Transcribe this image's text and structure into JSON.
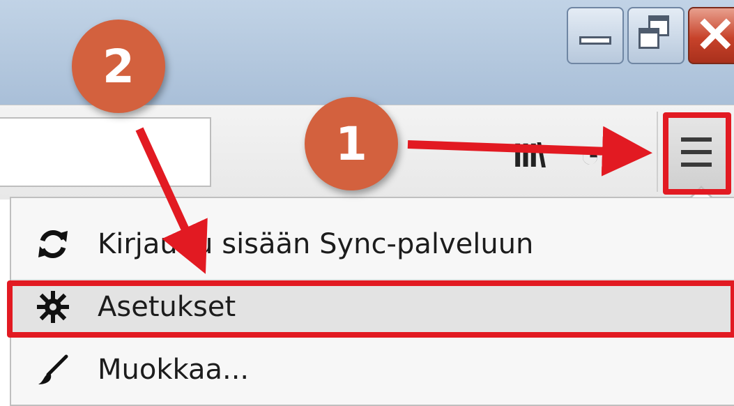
{
  "window": {
    "close_glyph": "✕"
  },
  "toolbar": {
    "bookmarks_icon": "bookmarks-icon",
    "history_icon": "history-icon",
    "menu_button_icon": "hamburger-menu-icon"
  },
  "menu": {
    "items": [
      {
        "label": "Kirjaudu sisään Sync-palveluun",
        "icon": "sync-icon"
      },
      {
        "label": "Asetukset",
        "icon": "gear-icon"
      },
      {
        "label": "Muokkaa...",
        "icon": "brush-icon"
      }
    ]
  },
  "annotations": {
    "step1": "1",
    "step2": "2",
    "highlight_color": "#e21a22",
    "badge_color": "#d3613e"
  }
}
